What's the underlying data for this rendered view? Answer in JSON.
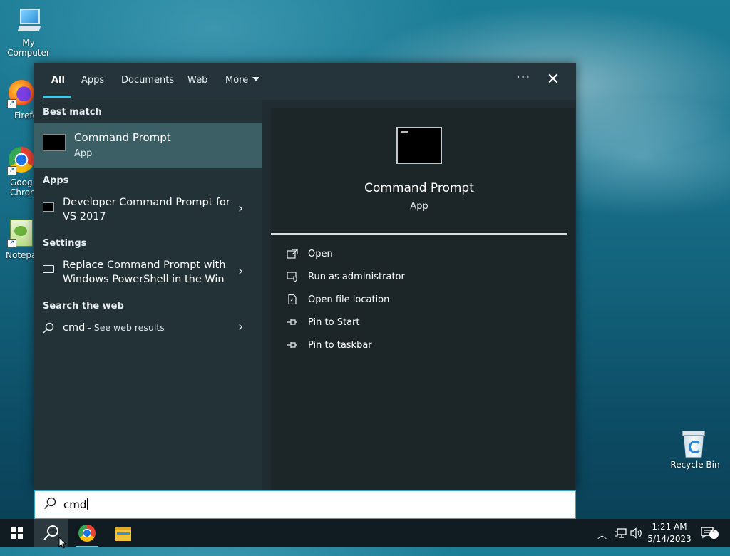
{
  "desktop": {
    "icons": [
      {
        "label": "My Computer"
      },
      {
        "label": "Firefo"
      },
      {
        "label": "Goog Chron"
      },
      {
        "label": "Notepa"
      },
      {
        "label": "Recycle Bin"
      }
    ]
  },
  "tabs": [
    "All",
    "Apps",
    "Documents",
    "Web",
    "More"
  ],
  "header": {
    "more_dots": "···",
    "close": "✕"
  },
  "best_match": {
    "heading": "Best match",
    "title": "Command Prompt",
    "subtitle": "App"
  },
  "apps": {
    "heading": "Apps",
    "items": [
      {
        "label": "Developer Command Prompt for VS 2017"
      }
    ]
  },
  "settings": {
    "heading": "Settings",
    "items": [
      {
        "label": "Replace Command Prompt with Windows PowerShell in the Win"
      }
    ]
  },
  "web": {
    "heading": "Search the web",
    "query": "cmd",
    "suffix": " - See web results"
  },
  "preview": {
    "title": "Command Prompt",
    "subtitle": "App",
    "actions": [
      {
        "label": "Open",
        "icon": "open-icon"
      },
      {
        "label": "Run as administrator",
        "icon": "shield-icon"
      },
      {
        "label": "Open file location",
        "icon": "file-location-icon"
      },
      {
        "label": "Pin to Start",
        "icon": "pin-icon"
      },
      {
        "label": "Pin to taskbar",
        "icon": "pin-icon"
      }
    ]
  },
  "search": {
    "value": "cmd"
  },
  "taskbar": {
    "time": "1:21 AM",
    "date": "5/14/2023",
    "notification_count": "1"
  }
}
